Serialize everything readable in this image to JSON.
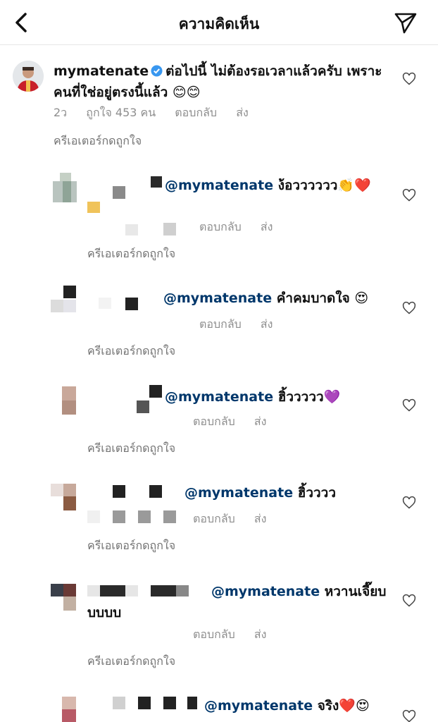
{
  "header": {
    "title": "ความคิดเห็น"
  },
  "caption": {
    "username": "mymatenate",
    "text_line1": "ต่อไปนี้ ไม่ต้องรอเวลาแล้วครับ เพราะ",
    "text_line2": "คนที่ใช่อยู่ตรงนี้แล้ว 😊😊",
    "time": "2ว",
    "likes": "ถูกใจ 453 คน",
    "reply": "ตอบกลับ",
    "send": "ส่ง",
    "creator_liked": "ครีเอเตอร์กดถูกใจ"
  },
  "comments": [
    {
      "mention": "@mymatenate",
      "text": "ง้อวววววว👏❤️",
      "reply": "ตอบกลับ",
      "send": "ส่ง",
      "creator_liked": "ครีเอเตอร์กดถูกใจ"
    },
    {
      "mention": "@mymatenate",
      "text": "คำคมบาดใจ 😍",
      "reply": "ตอบกลับ",
      "send": "ส่ง",
      "creator_liked": "ครีเอเตอร์กดถูกใจ"
    },
    {
      "mention": "@mymatenate",
      "text": "ฮิ้ววววว💜",
      "reply": "ตอบกลับ",
      "send": "ส่ง",
      "creator_liked": "ครีเอเตอร์กดถูกใจ"
    },
    {
      "mention": "@mymatenate",
      "text": "ฮิ้วววว",
      "reply": "ตอบกลับ",
      "send": "ส่ง",
      "creator_liked": "ครีเอเตอร์กดถูกใจ"
    },
    {
      "mention": "@mymatenate",
      "text": "หวานเจี๊ยบ",
      "text_line2": "บบบบ",
      "reply": "ตอบกลับ",
      "send": "ส่ง",
      "creator_liked": "ครีเอเตอร์กดถูกใจ"
    },
    {
      "mention": "@mymatenate",
      "text": "จริง❤️😍"
    }
  ],
  "icons": {
    "back": "chevron-left-icon",
    "share": "paper-plane-icon",
    "like": "heart-outline-icon",
    "verified": "verified-badge-icon"
  },
  "colors": {
    "mention": "#00376b",
    "verified": "#3897f0",
    "meta": "#8e8e8e"
  }
}
